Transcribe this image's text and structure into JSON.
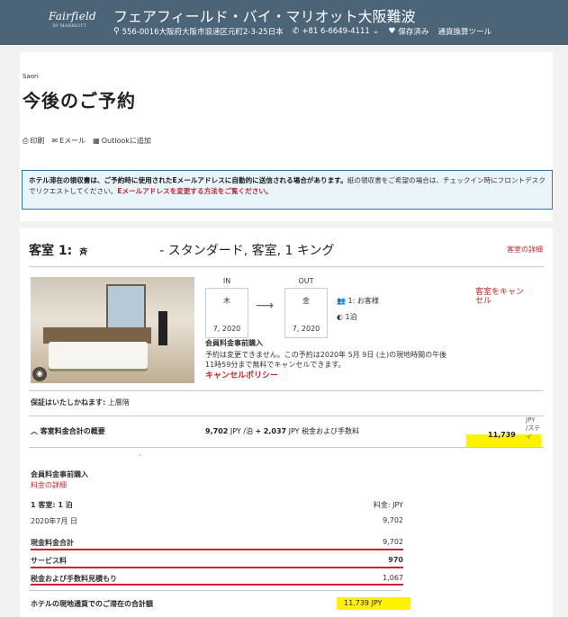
{
  "header": {
    "logo_line1": "Fairfield",
    "logo_line2": "BY MARRIOTT",
    "hotel_name": "フェアフィールド・バイ・マリオット大阪難波",
    "address": "556-0016大阪府大阪市浪速区元町2-3-25日本",
    "phone": "+81 6-6649-4111",
    "saved": "保存済み",
    "currency": "通貨換算ツール"
  },
  "account": {
    "user": "Saori",
    "title": "今後のご予約"
  },
  "actions": {
    "print": "印刷",
    "email": "Eメール",
    "outlook": "Outlookに追加"
  },
  "notice": {
    "bold": "ホテル滞在の領収書は、ご予約時に使用されたEメールアドレスに自動的に送信される場合があります。",
    "normal": "紙の領収書をご希望の場合は、チェックイン時にフロントデスクでリクエストしてください。",
    "link": "Eメールアドレスを変更する方法をご覧ください。"
  },
  "room": {
    "label": "客室 1:",
    "guest_name": "斉",
    "type": "- スタンダード, 客室, 1 キング",
    "detail_link": "客室の詳細",
    "cancel_button": "客室をキャンセル",
    "checkin": {
      "label": "IN",
      "weekday": "木",
      "date": "7, 2020"
    },
    "checkout": {
      "label": "OUT",
      "weekday": "金",
      "date": "7, 2020"
    },
    "guests": "1: お客様",
    "nights": "1泊",
    "rate_name": "会員料金事前購入",
    "rate_desc": "予約は変更できません。この予約は2020年 5月 9日 (土)の現地時間の午後11時59分まで無料でキャンセルできます。",
    "cancel_policy": "キャンセルポリシー",
    "guarantee_label": "保証はいたしかねます:",
    "guarantee_value": "上層階"
  },
  "summary": {
    "label": "客室料金合計の概要",
    "per_night_value": "9,702",
    "per_night_unit": "JPY /泊",
    "fee_value": "2,037",
    "fee_unit": "JPY 税金および手数料",
    "total": "11,739",
    "currency": "JPY",
    "per_stay": "/ステイ"
  },
  "breakdown": {
    "rate_title": "会員料金事前購入",
    "rate_detail": "料金の詳細",
    "room_label": "1 客室: 1 泊",
    "currency_label": "料金: JPY",
    "date_label": "2020年7月 日",
    "date_value": "9,702",
    "cash_total_label": "現金料金合計",
    "cash_total_value": "9,702",
    "service_label": "サービス料",
    "service_value": "970",
    "tax_label": "税金および手数料見積もり",
    "tax_value": "1,067",
    "grand_label": "ホテルの現地通貨でのご滞在の合計額",
    "grand_value": "11,739 JPY"
  }
}
